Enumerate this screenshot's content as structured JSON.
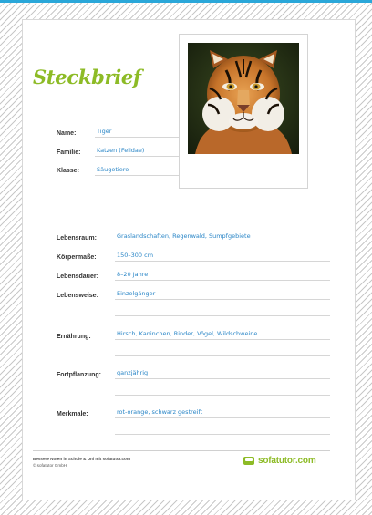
{
  "title": "Steckbrief",
  "photo": {
    "alt": "Tiger"
  },
  "fields": {
    "name": {
      "label": "Name:",
      "value": "Tiger"
    },
    "familie": {
      "label": "Familie:",
      "value": "Katzen (Felidae)"
    },
    "klasse": {
      "label": "Klasse:",
      "value": "Säugetiere"
    },
    "lebensraum": {
      "label": "Lebensraum:",
      "value": "Graslandschaften, Regenwald, Sumpfgebiete"
    },
    "koerpermasse": {
      "label": "Körpermaße:",
      "value": "150–300 cm"
    },
    "lebensdauer": {
      "label": "Lebensdauer:",
      "value": "8–20 Jahre"
    },
    "lebensweise": {
      "label": "Lebensweise:",
      "value": "Einzelgänger"
    },
    "ernaehrung": {
      "label": "Ernährung:",
      "value": "Hirsch, Kaninchen, Rinder, Vögel, Wildschweine"
    },
    "fortpflanzung": {
      "label": "Fortpflanzung:",
      "value": "ganzjährig"
    },
    "merkmale": {
      "label": "Merkmale:",
      "value": "rot-orange, schwarz gestreift"
    }
  },
  "footer": {
    "line1": "Bessere Noten in Schule & Uni mit sofatutor.com",
    "line2": "© sofatutor GmbH",
    "logo_text": "sofatutor.com"
  },
  "colors": {
    "title_green": "#8dbb26",
    "value_blue": "#2a86c7",
    "top_bar_blue": "#2aa7d9"
  }
}
